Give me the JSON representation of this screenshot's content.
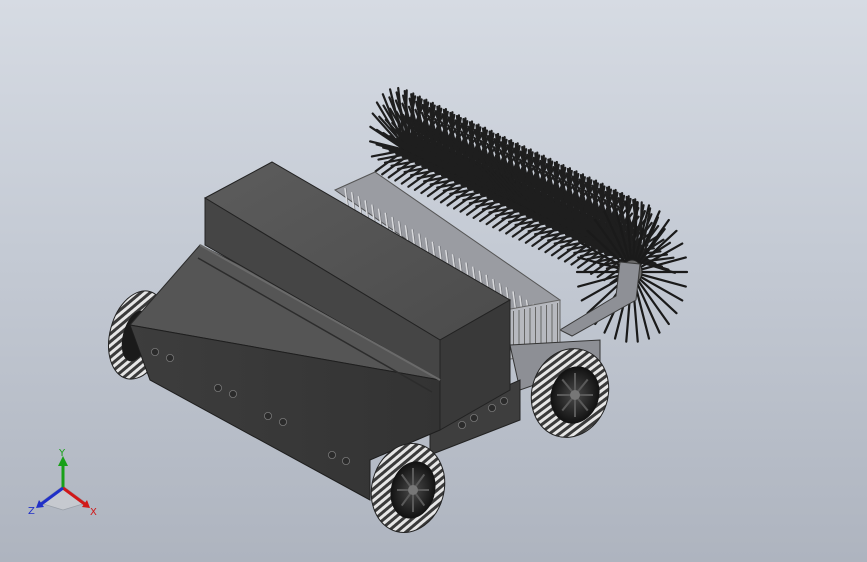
{
  "viewport": {
    "background_top": "#d6dbe3",
    "background_bottom": "#aeb4bf"
  },
  "model": {
    "body_color": "#565656",
    "bristle_color": "#1e1e1e",
    "tire_color": "#2a2a2a"
  },
  "triad": {
    "x_label": "X",
    "y_label": "Y",
    "z_label": "Z",
    "x_color": "#d01818",
    "y_color": "#18a018",
    "z_color": "#2030c8"
  }
}
